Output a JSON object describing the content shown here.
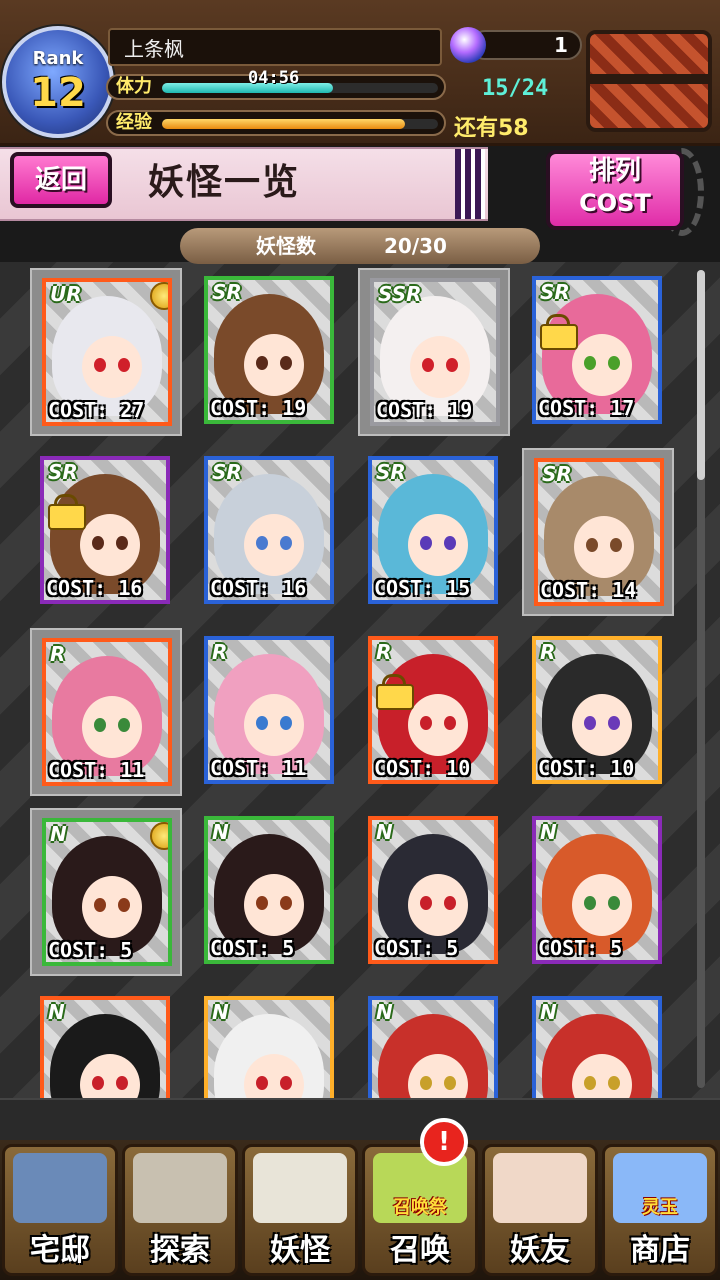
{
  "header": {
    "rank_label": "Rank",
    "rank_value": "12",
    "player_name": "上条枫",
    "stamina_label": "体力",
    "stamina_timer": "04:56",
    "stamina_value": "15/24",
    "stamina_fill": 0.62,
    "exp_label": "经验",
    "exp_remaining": "还有58",
    "exp_fill": 0.88,
    "orb_count": "1"
  },
  "toolbar": {
    "back_label": "返回",
    "page_title": "妖怪一览",
    "sort_line1": "排列",
    "sort_line2": "COST"
  },
  "inventory": {
    "count_label": "妖怪数",
    "count_value": "20/30"
  },
  "cards": [
    {
      "rarity": "UR",
      "cost": "COST: 27",
      "selected": true,
      "medal": true,
      "lock": false,
      "frame": "#ff5a1a",
      "hair": "#e8e8ee",
      "eyes": "#d0202a"
    },
    {
      "rarity": "SR",
      "cost": "COST: 19",
      "selected": false,
      "medal": false,
      "lock": false,
      "frame": "#3ab83a",
      "hair": "#7a4a2a",
      "eyes": "#5a2a1a"
    },
    {
      "rarity": "SSR",
      "cost": "COST: 19",
      "selected": true,
      "medal": false,
      "lock": false,
      "frame": "#9a9aa0",
      "hair": "#f4f0f0",
      "eyes": "#d0202a"
    },
    {
      "rarity": "SR",
      "cost": "COST: 17",
      "selected": false,
      "medal": false,
      "lock": true,
      "frame": "#2a62d8",
      "hair": "#e86a9a",
      "eyes": "#4aa02a"
    },
    {
      "rarity": "SR",
      "cost": "COST: 16",
      "selected": false,
      "medal": false,
      "lock": true,
      "frame": "#8a2ab8",
      "hair": "#7a4a2a",
      "eyes": "#5a2a1a"
    },
    {
      "rarity": "SR",
      "cost": "COST: 16",
      "selected": false,
      "medal": false,
      "lock": false,
      "frame": "#2a62d8",
      "hair": "#c8d0da",
      "eyes": "#4a7ad0"
    },
    {
      "rarity": "SR",
      "cost": "COST: 15",
      "selected": false,
      "medal": false,
      "lock": false,
      "frame": "#2a62d8",
      "hair": "#5ab8d8",
      "eyes": "#5a3ab8"
    },
    {
      "rarity": "SR",
      "cost": "COST: 14",
      "selected": true,
      "medal": false,
      "lock": false,
      "frame": "#ff5a1a",
      "hair": "#a88a6a",
      "eyes": "#7a4a2a"
    },
    {
      "rarity": "R",
      "cost": "COST: 11",
      "selected": true,
      "medal": false,
      "lock": false,
      "frame": "#ff5a1a",
      "hair": "#e87aa0",
      "eyes": "#3a8a3a"
    },
    {
      "rarity": "R",
      "cost": "COST: 11",
      "selected": false,
      "medal": false,
      "lock": false,
      "frame": "#2a62d8",
      "hair": "#f0a0c0",
      "eyes": "#3a7ad0"
    },
    {
      "rarity": "R",
      "cost": "COST: 10",
      "selected": false,
      "medal": false,
      "lock": true,
      "frame": "#ff5a1a",
      "hair": "#c8202a",
      "eyes": "#c8202a"
    },
    {
      "rarity": "R",
      "cost": "COST: 10",
      "selected": false,
      "medal": false,
      "lock": false,
      "frame": "#ffb02a",
      "hair": "#2a2a2a",
      "eyes": "#6a3ab8"
    },
    {
      "rarity": "N",
      "cost": "COST: 5",
      "selected": true,
      "medal": true,
      "lock": false,
      "frame": "#3ab83a",
      "hair": "#2a1a1a",
      "eyes": "#8a3a1a"
    },
    {
      "rarity": "N",
      "cost": "COST: 5",
      "selected": false,
      "medal": false,
      "lock": false,
      "frame": "#3ab83a",
      "hair": "#2a1a1a",
      "eyes": "#8a3a1a"
    },
    {
      "rarity": "N",
      "cost": "COST: 5",
      "selected": false,
      "medal": false,
      "lock": false,
      "frame": "#ff5a1a",
      "hair": "#2a2a34",
      "eyes": "#c8202a"
    },
    {
      "rarity": "N",
      "cost": "COST: 5",
      "selected": false,
      "medal": false,
      "lock": false,
      "frame": "#8a2ab8",
      "hair": "#d85a2a",
      "eyes": "#3a8a3a"
    },
    {
      "rarity": "N",
      "cost": "",
      "selected": false,
      "medal": false,
      "lock": false,
      "frame": "#ff5a1a",
      "hair": "#1a1a1a",
      "eyes": "#c8202a"
    },
    {
      "rarity": "N",
      "cost": "",
      "selected": false,
      "medal": false,
      "lock": false,
      "frame": "#ffb02a",
      "hair": "#f0f0f0",
      "eyes": "#c8202a"
    },
    {
      "rarity": "N",
      "cost": "",
      "selected": false,
      "medal": false,
      "lock": false,
      "frame": "#2a62d8",
      "hair": "#c8302a",
      "eyes": "#c8a02a"
    },
    {
      "rarity": "N",
      "cost": "",
      "selected": false,
      "medal": false,
      "lock": false,
      "frame": "#2a62d8",
      "hair": "#c8302a",
      "eyes": "#c8a02a"
    }
  ],
  "nav": [
    {
      "label": "宅邸",
      "icon": "mansion-icon",
      "art": "#6a8ab8"
    },
    {
      "label": "探索",
      "icon": "magnifier-icon",
      "art": "#c8c0b0"
    },
    {
      "label": "妖怪",
      "icon": "scroll-icon",
      "art": "#e8e4d8"
    },
    {
      "label": "召唤",
      "icon": "summon-icon",
      "art": "#b8d858",
      "sub": "召唤祭"
    },
    {
      "label": "妖友",
      "icon": "friend-icon",
      "art": "#f0d8c8"
    },
    {
      "label": "商店",
      "icon": "spirit-orb-icon",
      "art": "#8ab8f8",
      "sub": "灵玉"
    }
  ],
  "alert_badge": "!"
}
